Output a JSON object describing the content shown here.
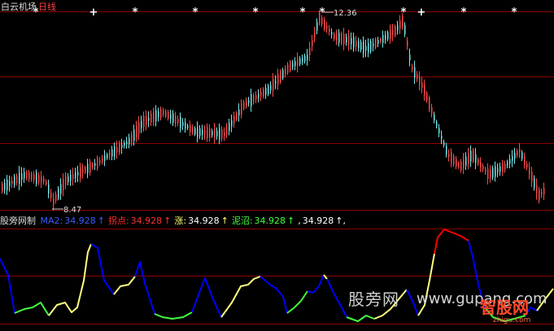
{
  "header": {
    "title": "白云机场",
    "period": "日线"
  },
  "price_chart": {
    "high_label": "12.36",
    "low_label": "8.47",
    "star_glyph": "*",
    "plus_glyph": "+",
    "colors": {
      "up": "#ff4a4a",
      "down": "#74e8ea",
      "grid": "#8b0000"
    }
  },
  "indicator": {
    "name": "股旁网制",
    "items": [
      {
        "label": "MA2:",
        "value": "34.928",
        "arrow": "↑",
        "label_color": "#3c5cff",
        "value_color": "#3c5cff"
      },
      {
        "label": "拐点:",
        "value": "34.928",
        "arrow": "↑",
        "label_color": "#ff3030",
        "value_color": "#ff3030"
      },
      {
        "label": "涨:",
        "value": "34.928",
        "arrow": "↑",
        "label_color": "#ffff70",
        "value_color": "#ffffff"
      },
      {
        "label": "泥沼:",
        "value": "34.928",
        "arrow": "↑",
        "label_color": "#40ff40",
        "value_color": "#40ff40"
      },
      {
        "label": ",",
        "value": "34.928",
        "arrow": "↑,",
        "label_color": "#ffffff",
        "value_color": "#ffffff"
      }
    ],
    "colors": {
      "blue": "#0000ff",
      "red": "#ff0000",
      "yellow": "#ffff80",
      "green": "#40ff40"
    }
  },
  "watermark": {
    "text1": "股旁网",
    "text2": "www.gupang.com",
    "brand": "智股网",
    "brand_sub": "zhigu.com"
  }
}
